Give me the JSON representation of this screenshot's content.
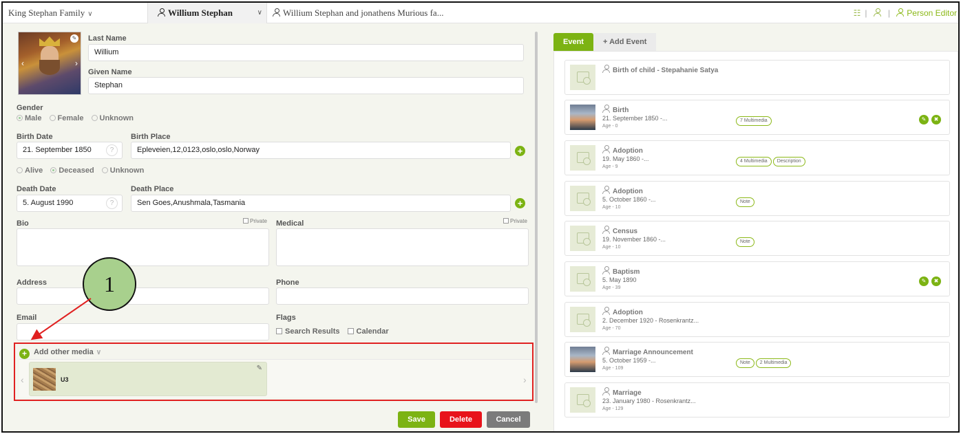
{
  "topbar": {
    "family": "King Stephan Family",
    "person": "Willium Stephan",
    "relationship": "Willium Stephan and jonathens Murious fa...",
    "editor_label": "Person Editor"
  },
  "form": {
    "last_name_label": "Last Name",
    "last_name_value": "Willium",
    "given_name_label": "Given Name",
    "given_name_value": "Stephan",
    "gender_label": "Gender",
    "gender_options": [
      "Male",
      "Female",
      "Unknown"
    ],
    "gender_selected": "Male",
    "birth_date_label": "Birth Date",
    "birth_date_value": "21. September 1850",
    "birth_place_label": "Birth Place",
    "birth_place_value": "Epleveien,12,0123,oslo,oslo,Norway",
    "status_options": [
      "Alive",
      "Deceased",
      "Unknown"
    ],
    "status_selected": "Deceased",
    "death_date_label": "Death Date",
    "death_date_value": "5. August 1990",
    "death_place_label": "Death Place",
    "death_place_value": "Sen Goes,Anushmala,Tasmania",
    "help_glyph": "?",
    "bio_label": "Bio",
    "medical_label": "Medical",
    "private_label": "Private",
    "address_label": "Address",
    "phone_label": "Phone",
    "email_label": "Email",
    "flags_label": "Flags",
    "flag_search": "Search Results",
    "flag_calendar": "Calendar"
  },
  "media": {
    "title": "Add other media",
    "items": [
      {
        "name": "U3"
      }
    ]
  },
  "buttons": {
    "save": "Save",
    "delete": "Delete",
    "cancel": "Cancel"
  },
  "callout": {
    "number": "1"
  },
  "events": {
    "tab_active": "Event",
    "tab_add": "+ Add Event",
    "list": [
      {
        "title": "Birth of child - Stepahanie Satya",
        "date": "",
        "age": "",
        "badges": [],
        "photo": false,
        "actions": false
      },
      {
        "title": "Birth",
        "date": "21. September 1850 -...",
        "age": "Age - 0",
        "badges": [
          "7 Multimedia"
        ],
        "photo": true,
        "actions": true
      },
      {
        "title": "Adoption",
        "date": "19. May 1860 -...",
        "age": "Age - 9",
        "badges": [
          "4 Multimedia",
          "Description"
        ],
        "photo": false,
        "actions": false
      },
      {
        "title": "Adoption",
        "date": "5. October 1860 -...",
        "age": "Age - 10",
        "badges": [
          "Note"
        ],
        "photo": false,
        "actions": false
      },
      {
        "title": "Census",
        "date": "19. November 1860 -...",
        "age": "Age - 10",
        "badges": [
          "Note"
        ],
        "photo": false,
        "actions": false
      },
      {
        "title": "Baptism",
        "date": "5. May 1890",
        "age": "Age - 39",
        "badges": [],
        "photo": false,
        "actions": true
      },
      {
        "title": "Adoption",
        "date": "2. December 1920 - Rosenkrantz...",
        "age": "Age - 70",
        "badges": [],
        "photo": false,
        "actions": false
      },
      {
        "title": "Marriage Announcement",
        "date": "5. October 1959 -...",
        "age": "Age - 109",
        "badges": [
          "Note",
          "2 Multimedia"
        ],
        "photo": true,
        "actions": false
      },
      {
        "title": "Marriage",
        "date": "23. January 1980 - Rosenkrantz...",
        "age": "Age - 129",
        "badges": [],
        "photo": false,
        "actions": false
      }
    ]
  },
  "colors": {
    "accent": "#7cb313",
    "delete": "#e8131a",
    "cancel": "#7b7b7b",
    "callout": "#a8d08d",
    "highlight": "#e02020"
  }
}
